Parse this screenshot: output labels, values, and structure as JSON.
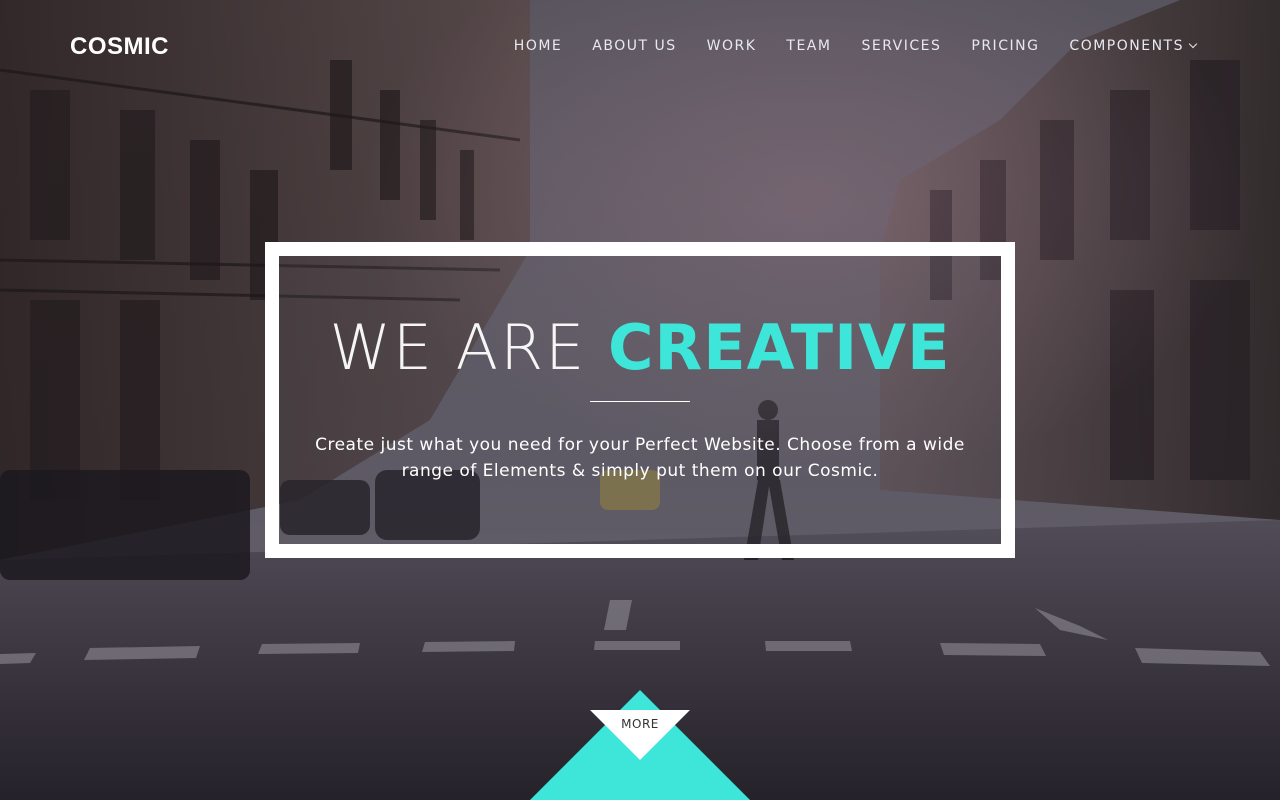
{
  "brand": {
    "logo": "COSMIC"
  },
  "nav": {
    "items": [
      {
        "label": "HOME"
      },
      {
        "label": "ABOUT US"
      },
      {
        "label": "WORK"
      },
      {
        "label": "TEAM"
      },
      {
        "label": "SERVICES"
      },
      {
        "label": "PRICING"
      },
      {
        "label": "COMPONENTS"
      }
    ]
  },
  "hero": {
    "headline_light": "WE ARE ",
    "headline_accent": "CREATIVE",
    "description_line1": "Create just what you need for your Perfect Website. Choose from a wide",
    "description_line2": "range of Elements & simply put them on our Cosmic.",
    "more_label": "MORE"
  },
  "colors": {
    "accent": "#3de6d9",
    "frame": "#ffffff"
  },
  "icons": {
    "components_dropdown": "chevron-down-icon"
  }
}
